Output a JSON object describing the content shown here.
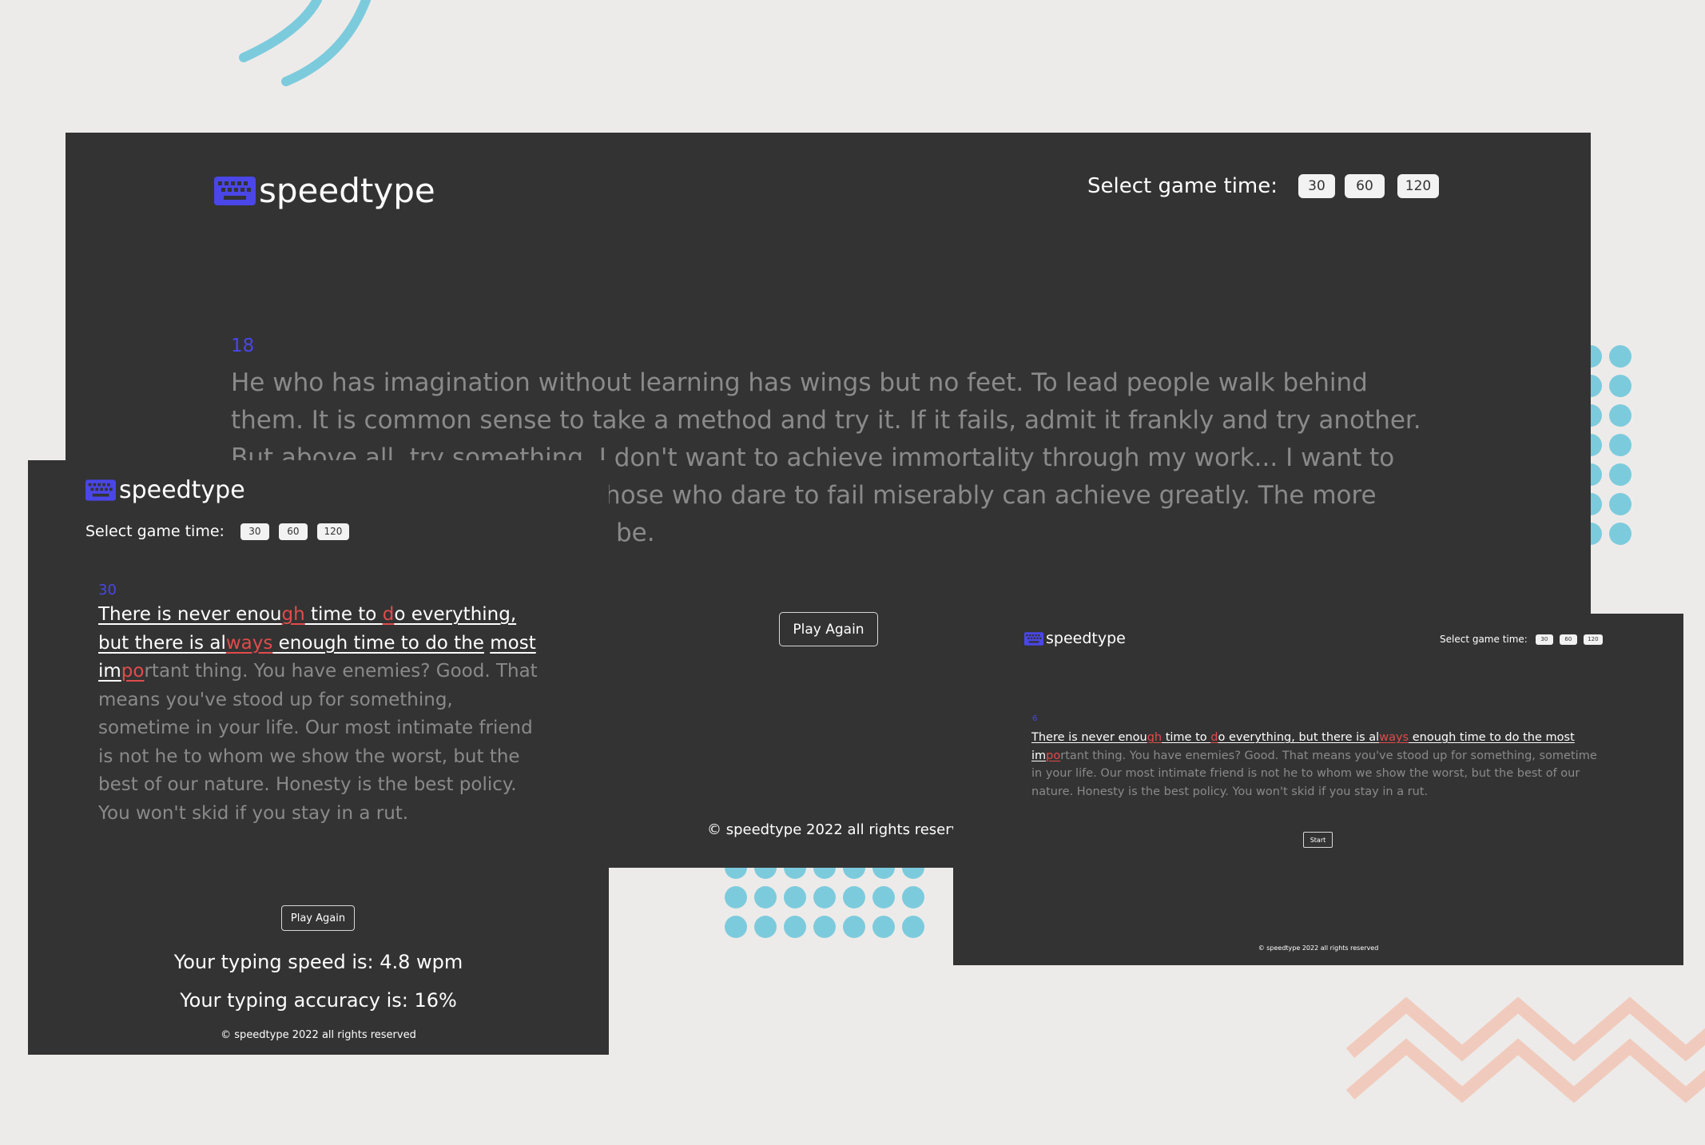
{
  "app": {
    "name": "speedtype"
  },
  "colors": {
    "background": "#edebe9",
    "panel": "#333333",
    "accent": "#4a46e8",
    "error": "#e24b4b",
    "pending_text": "#8a8a8a",
    "deco_blue": "#7ccbdd",
    "deco_peach": "#f0cbbd"
  },
  "main_screen": {
    "logo": "speedtype",
    "time_label": "Select game time:",
    "time_options": [
      "30",
      "60",
      "120"
    ],
    "timer": "18",
    "quote_line1": "He who has imagination without learning has wings but no feet. To lead people walk behind",
    "quote_line2": "them. It is common sense to take a method and try it. If it fails, admit it frankly and try another.",
    "quote_line3": "But above all, try something. I don't want to achieve immortality through my work... I want to",
    "quote_line4": "hose who dare to fail miserably can achieve greatly. The more",
    "quote_line5": "be.",
    "action_button": "Play Again",
    "footer": "© speedtype 2022 all rights reserved"
  },
  "mobile_screen": {
    "logo": "speedtype",
    "time_label": "Select game time:",
    "time_options": [
      "30",
      "60",
      "120"
    ],
    "timer": "30",
    "quote_segments": [
      "There is never enou",
      "gh",
      " time to ",
      "d",
      "o everything,",
      "but there is al",
      "ways",
      " enough time to do the",
      "most im",
      "po",
      "rtant thing. You have enemies? Good. That means you've stood up for something, sometime in your life. Our most intimate friend is not he to whom we show the worst, but the best of our nature. Honesty is the best policy. You won't skid if you stay in a rut."
    ],
    "action_button": "Play Again",
    "speed_result": "Your typing speed is: 4.8 wpm",
    "accuracy_result": "Your typing accuracy is: 16%",
    "footer": "© speedtype 2022 all rights reserved"
  },
  "tablet_screen": {
    "logo": "speedtype",
    "time_label": "Select game time:",
    "time_options": [
      "30",
      "60",
      "120"
    ],
    "timer": "6",
    "quote_segments": [
      "There is never enou",
      "gh",
      " time to ",
      "d",
      "o everything, but there is al",
      "ways",
      " enough time to do the most",
      "im",
      "po",
      "rtant thing. You have enemies? Good. That means you've stood up for something, sometime in your life. Our most intimate friend is not he to whom we show the worst, but the best of our nature. Honesty is the best policy. You won't skid if you stay in a rut."
    ],
    "action_button": "Start",
    "footer": "© speedtype 2022 all rights reserved"
  }
}
